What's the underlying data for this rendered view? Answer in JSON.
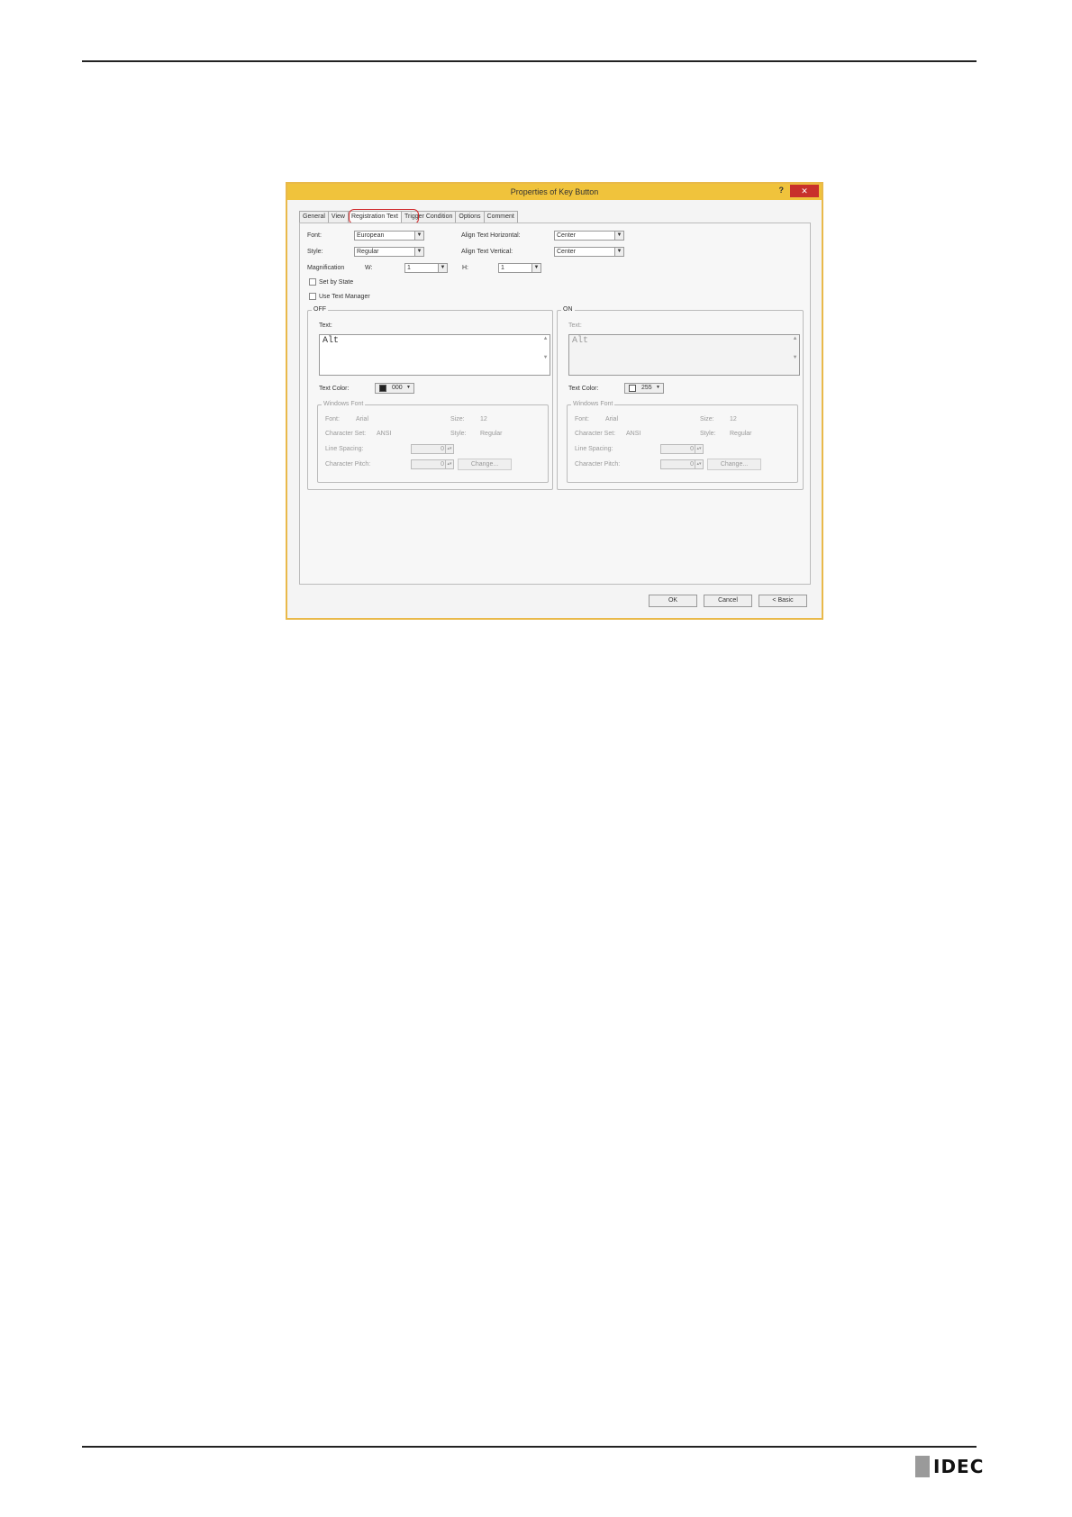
{
  "logo": {
    "text": "IDEC"
  },
  "dialog": {
    "title": "Properties of Key Button",
    "help_label": "?",
    "close_label": "✕",
    "tabs": [
      "General",
      "View",
      "Registration Text",
      "Trigger Condition",
      "Options",
      "Comment"
    ],
    "active_tab": "Registration Text",
    "font_label": "Font:",
    "font_value": "European",
    "style_label": "Style:",
    "style_value": "Regular",
    "magnification_label": "Magnification",
    "w_label": "W:",
    "w_value": "1",
    "h_label": "H:",
    "h_value": "1",
    "align_h_label": "Align Text Horizontal:",
    "align_h_value": "Center",
    "align_v_label": "Align Text Vertical:",
    "align_v_value": "Center",
    "set_by_state_label": "Set by State",
    "use_text_manager_label": "Use Text Manager",
    "off": {
      "group_label": "OFF",
      "text_label": "Text:",
      "text_value": "Alt",
      "text_color_label": "Text Color:",
      "text_color_value": "000",
      "swatch_color": "#222222",
      "windows_font_label": "Windows Font",
      "font_label": "Font:",
      "font_value": "Arial",
      "size_label": "Size:",
      "size_value": "12",
      "charset_label": "Character Set:",
      "charset_value": "ANSI",
      "style_label": "Style:",
      "style_value": "Regular",
      "line_spacing_label": "Line Spacing:",
      "line_spacing_value": "0",
      "char_pitch_label": "Character Pitch:",
      "char_pitch_value": "0",
      "change_label": "Change..."
    },
    "on": {
      "group_label": "ON",
      "text_label": "Text:",
      "text_value": "Alt",
      "text_color_label": "Text Color:",
      "text_color_value": "255",
      "swatch_color": "#ffffff",
      "windows_font_label": "Windows Font",
      "font_label": "Font:",
      "font_value": "Arial",
      "size_label": "Size:",
      "size_value": "12",
      "charset_label": "Character Set:",
      "charset_value": "ANSI",
      "style_label": "Style:",
      "style_value": "Regular",
      "line_spacing_label": "Line Spacing:",
      "line_spacing_value": "0",
      "char_pitch_label": "Character Pitch:",
      "char_pitch_value": "0",
      "change_label": "Change..."
    },
    "ok_label": "OK",
    "cancel_label": "Cancel",
    "basic_label": "< Basic"
  },
  "colors": {
    "titlebar": "#f0c33c",
    "close": "#c8302b",
    "tab_highlight": "#d0282a"
  }
}
